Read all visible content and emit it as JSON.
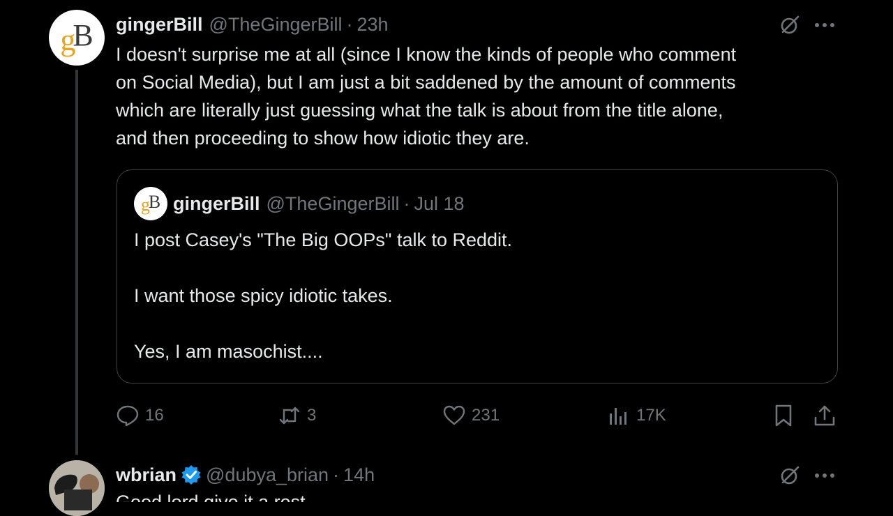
{
  "tweet1": {
    "author_name": "gingerBill",
    "author_handle": "@TheGingerBill",
    "separator": "·",
    "time": "23h",
    "avatar_letters": {
      "g": "g",
      "b": "B"
    },
    "body": "I doesn't surprise me at all (since I know the kinds of people who comment\non Social Media), but I am just a bit saddened by the amount of comments\nwhich are literally just guessing what the talk is about from the title alone,\nand then proceeding to show how idiotic they are.",
    "quote": {
      "author_name": "gingerBill",
      "author_handle": "@TheGingerBill",
      "separator": "·",
      "time": "Jul 18",
      "text": "I post Casey's \"The Big OOPs\" talk to Reddit.\n\nI want those spicy idiotic takes.\n\nYes, I am masochist...."
    },
    "actions": {
      "replies": "16",
      "reposts": "3",
      "likes": "231",
      "views": "17K"
    }
  },
  "tweet2": {
    "author_name": "wbrian",
    "author_handle": "@dubya_brian",
    "separator": "·",
    "time": "14h",
    "body_partial": "Good lord give it a rest"
  },
  "icons": [
    "grok-icon",
    "more-icon",
    "reply-icon",
    "repost-icon",
    "like-icon",
    "views-icon",
    "bookmark-icon",
    "share-icon",
    "verified-badge-icon"
  ],
  "colors": {
    "background": "#000000",
    "text": "#e7e9ea",
    "muted": "#71767b",
    "verified": "#1d9bf0",
    "border": "#3e4144"
  }
}
